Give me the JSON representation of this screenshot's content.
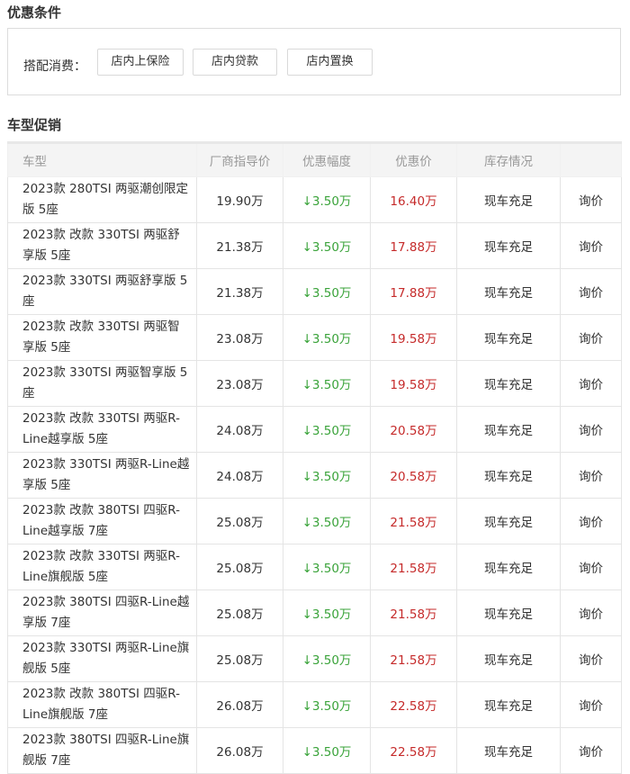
{
  "conditions": {
    "title": "优惠条件",
    "label": "搭配消费：",
    "buttons": [
      "店内上保险",
      "店内贷款",
      "店内置换"
    ]
  },
  "promotion": {
    "title": "车型促销",
    "headers": [
      "车型",
      "厂商指导价",
      "优惠幅度",
      "优惠价",
      "库存情况",
      ""
    ],
    "rows": [
      {
        "model": "2023款 280TSI 两驱潮创限定版 5座",
        "msrp": "19.90万",
        "discount": "↓3.50万",
        "price": "16.40万",
        "stock": "现车充足",
        "action": "询价"
      },
      {
        "model": "2023款 改款 330TSI 两驱舒享版 5座",
        "msrp": "21.38万",
        "discount": "↓3.50万",
        "price": "17.88万",
        "stock": "现车充足",
        "action": "询价"
      },
      {
        "model": "2023款 330TSI 两驱舒享版 5座",
        "msrp": "21.38万",
        "discount": "↓3.50万",
        "price": "17.88万",
        "stock": "现车充足",
        "action": "询价"
      },
      {
        "model": "2023款 改款 330TSI 两驱智享版 5座",
        "msrp": "23.08万",
        "discount": "↓3.50万",
        "price": "19.58万",
        "stock": "现车充足",
        "action": "询价"
      },
      {
        "model": "2023款 330TSI 两驱智享版 5座",
        "msrp": "23.08万",
        "discount": "↓3.50万",
        "price": "19.58万",
        "stock": "现车充足",
        "action": "询价"
      },
      {
        "model": "2023款 改款 330TSI 两驱R-Line越享版 5座",
        "msrp": "24.08万",
        "discount": "↓3.50万",
        "price": "20.58万",
        "stock": "现车充足",
        "action": "询价"
      },
      {
        "model": "2023款 330TSI 两驱R-Line越享版 5座",
        "msrp": "24.08万",
        "discount": "↓3.50万",
        "price": "20.58万",
        "stock": "现车充足",
        "action": "询价"
      },
      {
        "model": "2023款 改款 380TSI 四驱R-Line越享版 7座",
        "msrp": "25.08万",
        "discount": "↓3.50万",
        "price": "21.58万",
        "stock": "现车充足",
        "action": "询价"
      },
      {
        "model": "2023款 改款 330TSI 两驱R-Line旗舰版 5座",
        "msrp": "25.08万",
        "discount": "↓3.50万",
        "price": "21.58万",
        "stock": "现车充足",
        "action": "询价"
      },
      {
        "model": "2023款 380TSI 四驱R-Line越享版 7座",
        "msrp": "25.08万",
        "discount": "↓3.50万",
        "price": "21.58万",
        "stock": "现车充足",
        "action": "询价"
      },
      {
        "model": "2023款 330TSI 两驱R-Line旗舰版 5座",
        "msrp": "25.08万",
        "discount": "↓3.50万",
        "price": "21.58万",
        "stock": "现车充足",
        "action": "询价"
      },
      {
        "model": "2023款 改款 380TSI 四驱R-Line旗舰版 7座",
        "msrp": "26.08万",
        "discount": "↓3.50万",
        "price": "22.58万",
        "stock": "现车充足",
        "action": "询价"
      },
      {
        "model": "2023款 380TSI 四驱R-Line旗舰版 7座",
        "msrp": "26.08万",
        "discount": "↓3.50万",
        "price": "22.58万",
        "stock": "现车充足",
        "action": "询价"
      }
    ]
  },
  "colors": {
    "discount": "#3aa33a",
    "price": "#c52a2a",
    "header_bg": "#f4f4f4",
    "border": "#e4e4e4"
  }
}
